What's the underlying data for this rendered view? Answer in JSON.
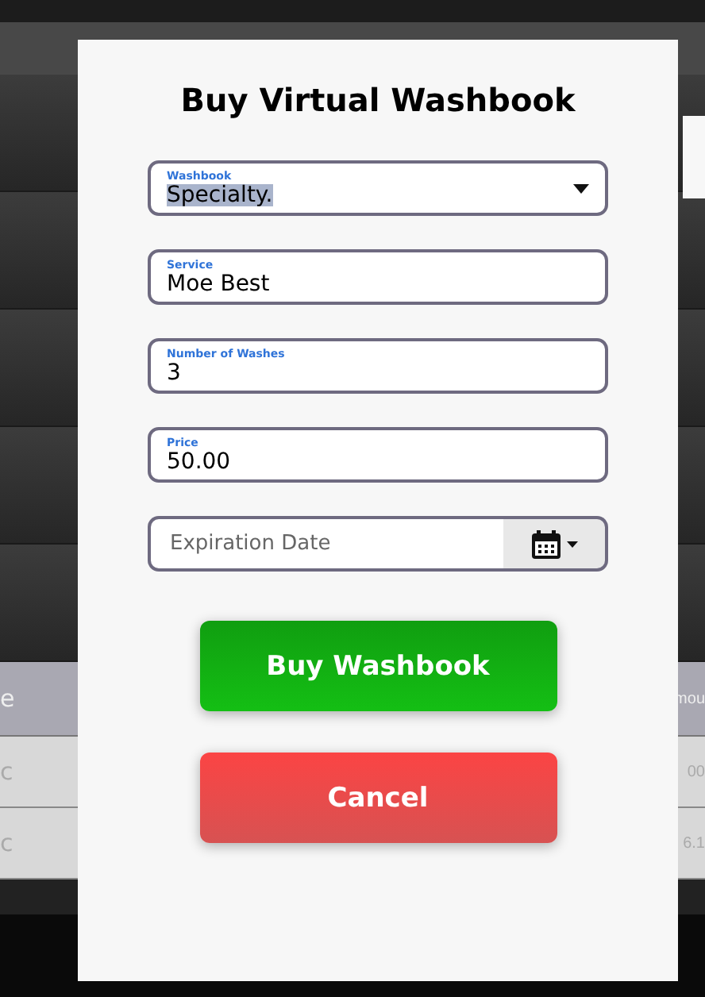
{
  "background": {
    "table": {
      "header": [
        "e",
        "mou"
      ],
      "rows": [
        [
          "c",
          "00"
        ],
        [
          "c",
          "6.1"
        ]
      ]
    }
  },
  "dialog": {
    "title": "Buy Virtual Washbook",
    "fields": [
      {
        "kind": "select",
        "label": "Washbook",
        "value": "Specialty.",
        "text_selected": true
      },
      {
        "kind": "text",
        "label": "Service",
        "value": "Moe Best"
      },
      {
        "kind": "text",
        "label": "Number of Washes",
        "value": "3"
      },
      {
        "kind": "text",
        "label": "Price",
        "value": "50.00"
      },
      {
        "kind": "date",
        "placeholder": "Expiration Date"
      }
    ],
    "buttons": [
      {
        "kind": "primary",
        "label": "Buy Washbook"
      },
      {
        "kind": "danger",
        "label": "Cancel"
      }
    ]
  }
}
